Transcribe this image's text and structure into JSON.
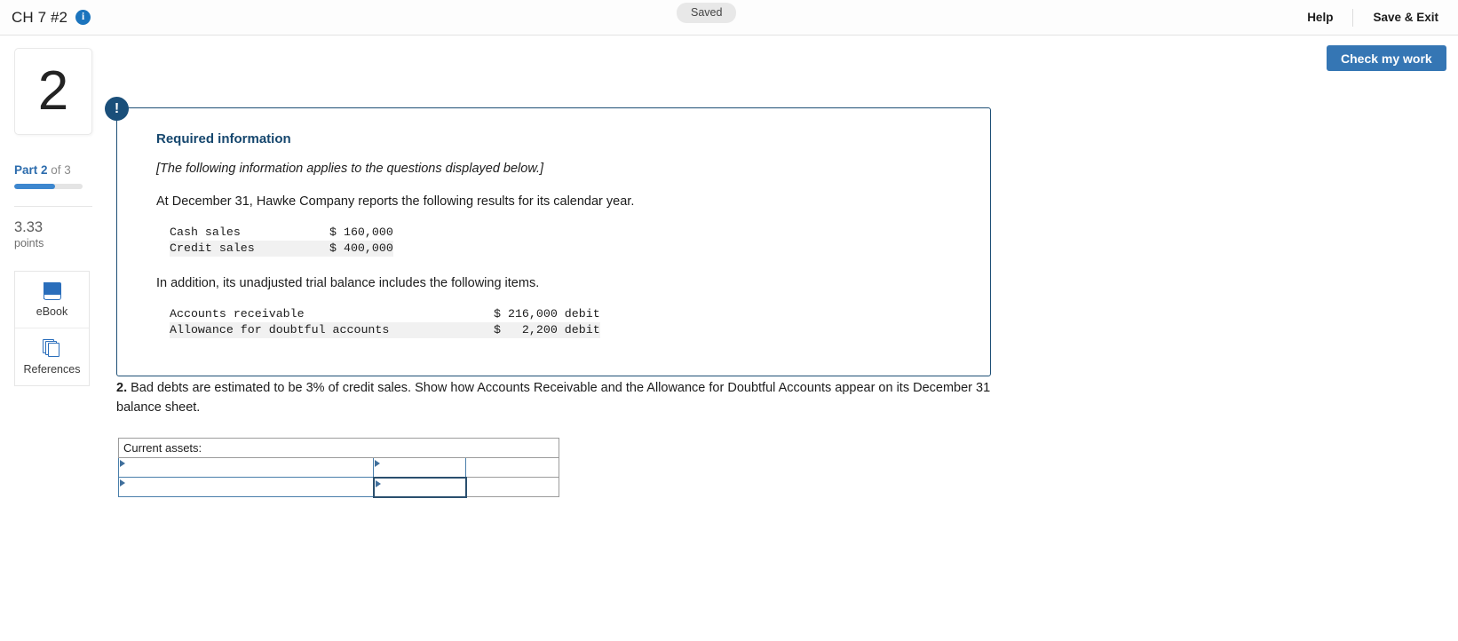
{
  "header": {
    "title": "CH 7 #2",
    "info_icon": "info-icon",
    "status_badge": "Saved",
    "help_label": "Help",
    "save_exit_label": "Save & Exit"
  },
  "actions": {
    "check_work_label": "Check my work"
  },
  "sidebar": {
    "question_number": "2",
    "part_prefix": "Part 2",
    "part_suffix": " of 3",
    "progress_percent": 60,
    "points_value": "3.33",
    "points_label": "points",
    "tools": [
      {
        "label": "eBook",
        "icon": "book-icon"
      },
      {
        "label": "References",
        "icon": "pages-icon"
      }
    ]
  },
  "required_info": {
    "badge": "!",
    "heading": "Required information",
    "italic_note": "[The following information applies to the questions displayed below.]",
    "intro_text": "At December 31, Hawke Company reports the following results for its calendar year.",
    "table1": [
      {
        "label": "Cash sales",
        "amount": "$ 160,000"
      },
      {
        "label": "Credit sales",
        "amount": "$ 400,000"
      }
    ],
    "second_text": "In addition, its unadjusted trial balance includes the following items.",
    "table2": [
      {
        "label": "Accounts receivable",
        "amount": "$ 216,000 debit"
      },
      {
        "label": "Allowance for doubtful accounts",
        "amount": "$   2,200 debit"
      }
    ]
  },
  "question": {
    "number": "2.",
    "text": " Bad debts are estimated to be 3% of credit sales. Show how Accounts Receivable and the Allowance for Doubtful Accounts appear on its December 31 balance sheet."
  },
  "answer_table": {
    "header_label": "Current assets:",
    "rows": [
      {
        "col_a": "",
        "col_b": "",
        "col_c": ""
      },
      {
        "col_a": "",
        "col_b": "",
        "col_c": ""
      }
    ]
  },
  "colors": {
    "accent_blue": "#3576b4",
    "panel_border": "#1e4f76",
    "input_border": "#4a7fab",
    "heading_blue": "#16476e"
  }
}
